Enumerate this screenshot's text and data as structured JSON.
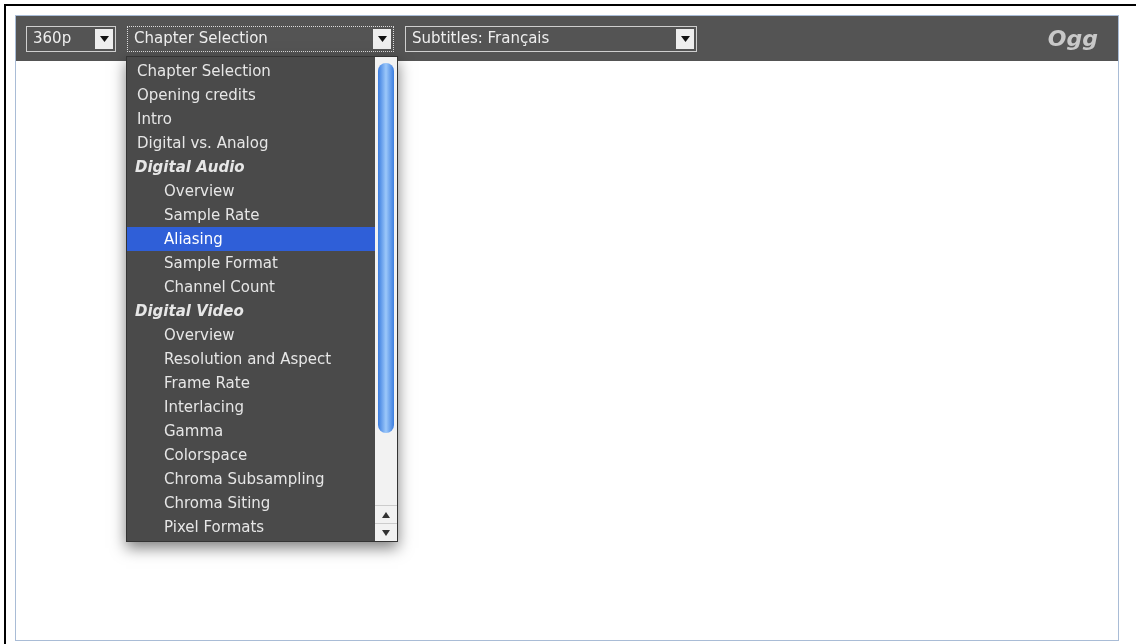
{
  "toolbar": {
    "quality_select": {
      "value": "360p"
    },
    "chapter_select": {
      "value": "Chapter Selection",
      "focused": true
    },
    "subtitles_select": {
      "value": "Subtitles: Français"
    },
    "brand": "Ogg"
  },
  "chapter_menu": {
    "items": [
      {
        "kind": "chapter",
        "label": "Chapter Selection",
        "selected": false
      },
      {
        "kind": "chapter",
        "label": "Opening credits",
        "selected": false
      },
      {
        "kind": "chapter",
        "label": "Intro",
        "selected": false
      },
      {
        "kind": "chapter",
        "label": "Digital vs. Analog",
        "selected": false
      },
      {
        "kind": "group",
        "label": "Digital Audio",
        "selected": false,
        "children": [
          {
            "kind": "chapter",
            "label": "Overview",
            "selected": false
          },
          {
            "kind": "chapter",
            "label": "Sample Rate",
            "selected": false
          },
          {
            "kind": "chapter",
            "label": "Aliasing",
            "selected": true
          },
          {
            "kind": "chapter",
            "label": "Sample Format",
            "selected": false
          },
          {
            "kind": "chapter",
            "label": "Channel Count",
            "selected": false
          }
        ]
      },
      {
        "kind": "group",
        "label": "Digital Video",
        "selected": false,
        "children": [
          {
            "kind": "chapter",
            "label": "Overview",
            "selected": false
          },
          {
            "kind": "chapter",
            "label": "Resolution and Aspect",
            "selected": false
          },
          {
            "kind": "chapter",
            "label": "Frame Rate",
            "selected": false
          },
          {
            "kind": "chapter",
            "label": "Interlacing",
            "selected": false
          },
          {
            "kind": "chapter",
            "label": "Gamma",
            "selected": false
          },
          {
            "kind": "chapter",
            "label": "Colorspace",
            "selected": false
          },
          {
            "kind": "chapter",
            "label": "Chroma Subsampling",
            "selected": false
          },
          {
            "kind": "chapter",
            "label": "Chroma Siting",
            "selected": false
          },
          {
            "kind": "chapter",
            "label": "Pixel Formats",
            "selected": false
          }
        ]
      }
    ]
  }
}
